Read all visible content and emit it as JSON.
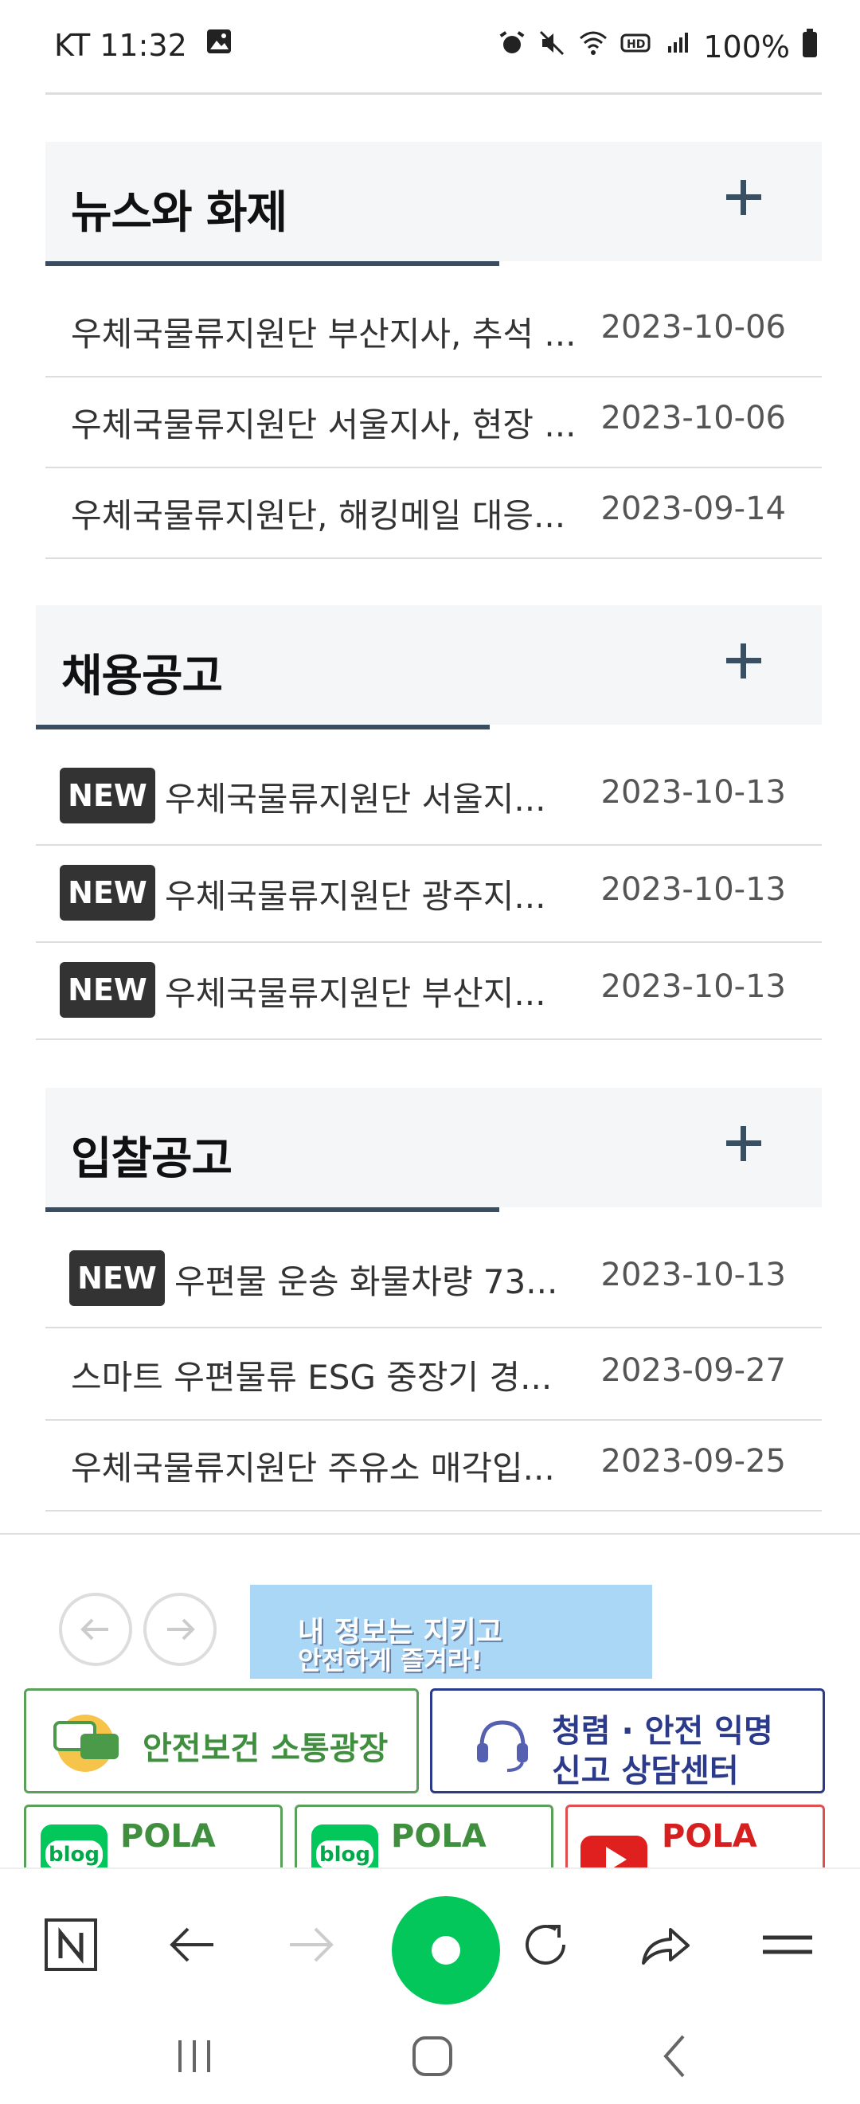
{
  "status_bar": {
    "time": "KT 11:32",
    "battery": "100%"
  },
  "sections": [
    {
      "title": "뉴스와 화제",
      "rows": [
        {
          "title": "우체국물류지원단 부산지사, 추석 ...",
          "date": "2023-10-06",
          "new": false
        },
        {
          "title": "우체국물류지원단 서울지사, 현장 ...",
          "date": "2023-10-06",
          "new": false
        },
        {
          "title": "우체국물류지원단, 해킹메일 대응...",
          "date": "2023-09-14",
          "new": false
        }
      ]
    },
    {
      "title": "채용공고",
      "rows": [
        {
          "title": "우체국물류지원단 서울지...",
          "date": "2023-10-13",
          "new": true
        },
        {
          "title": "우체국물류지원단 광주지...",
          "date": "2023-10-13",
          "new": true
        },
        {
          "title": "우체국물류지원단 부산지...",
          "date": "2023-10-13",
          "new": true
        }
      ]
    },
    {
      "title": "입찰공고",
      "rows": [
        {
          "title": "우편물 운송 화물차량 73...",
          "date": "2023-10-13",
          "new": true
        },
        {
          "title": "스마트 우편물류 ESG 중장기 경...",
          "date": "2023-09-27",
          "new": false
        },
        {
          "title": "우체국물류지원단 주유소 매각입...",
          "date": "2023-09-25",
          "new": false
        }
      ]
    }
  ],
  "new_badge": "NEW",
  "banner": {
    "line1": "내 정보는 지키고",
    "line2": "안전하게 즐겨라!"
  },
  "link_boxes": {
    "safety_comm": "안전보건 소통광장",
    "report_line1": "청렴 · 안전 익명",
    "report_line2": "신고 상담센터",
    "blog1": "POLA",
    "blog2": "POLA",
    "youtube": "POLA",
    "blog_tag": "blog"
  },
  "colors": {
    "accent_navy": "#3a4d60",
    "badge_bg": "#333333",
    "green": "#5aa05a",
    "navy": "#2b3a8a",
    "red": "#e05050",
    "naver_green": "#03c75a"
  }
}
